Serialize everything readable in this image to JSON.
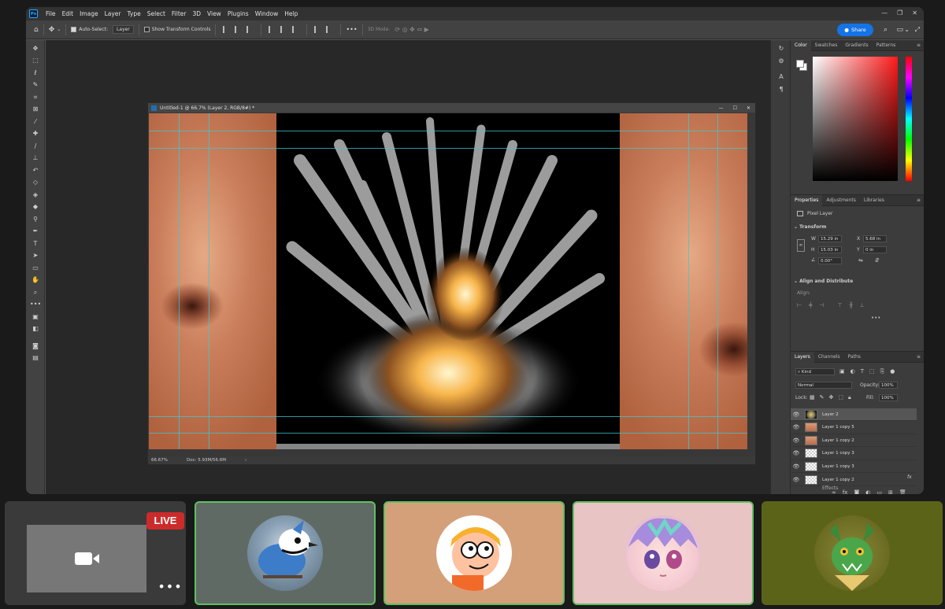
{
  "menubar": {
    "logo": "Ps",
    "items": [
      "File",
      "Edit",
      "Image",
      "Layer",
      "Type",
      "Select",
      "Filter",
      "3D",
      "View",
      "Plugins",
      "Window",
      "Help"
    ]
  },
  "options_bar": {
    "auto_select_label": "Auto-Select:",
    "auto_select_target": "Layer",
    "show_transform_label": "Show Transform Controls",
    "mode_3d_label": "3D Mode:",
    "share_label": "Share"
  },
  "document": {
    "title": "Untitled-1 @ 66.7% (Layer 2, RGB/8#) *",
    "zoom_status": "66.67%",
    "doc_size": "Doc: 5.93M/56.6M"
  },
  "color_panel": {
    "tabs": [
      "Color",
      "Swatches",
      "Gradients",
      "Patterns"
    ],
    "active_tab": "Color",
    "fg_color": "#ffffff",
    "bg_color": "#ffffff"
  },
  "properties_panel": {
    "tabs": [
      "Properties",
      "Adjustments",
      "Libraries"
    ],
    "active_tab": "Properties",
    "layer_type": "Pixel Layer",
    "transform_heading": "Transform",
    "w_label": "W",
    "w_value": "15.29 in",
    "h_label": "H",
    "h_value": "15.03 in",
    "x_label": "X",
    "x_value": "5.68 in",
    "y_label": "Y",
    "y_value": "0 in",
    "angle_value": "0.00°",
    "align_heading": "Align and Distribute",
    "align_label": "Align:"
  },
  "layers_panel": {
    "tabs": [
      "Layers",
      "Channels",
      "Paths"
    ],
    "active_tab": "Layers",
    "filter_kind": "Kind",
    "blend_mode": "Normal",
    "opacity_label": "Opacity:",
    "opacity_value": "100%",
    "lock_label": "Lock:",
    "fill_label": "Fill:",
    "fill_value": "100%",
    "layers": [
      {
        "name": "Layer 2",
        "thumb": "boom",
        "selected": true
      },
      {
        "name": "Layer 1 copy 5",
        "thumb": "face",
        "selected": false
      },
      {
        "name": "Layer 1 copy 2",
        "thumb": "face",
        "selected": false
      },
      {
        "name": "Layer 1 copy 3",
        "thumb": "empty",
        "selected": false
      },
      {
        "name": "Layer 1 copy 3",
        "thumb": "empty",
        "selected": false
      },
      {
        "name": "Layer 1 copy 2",
        "thumb": "empty",
        "selected": false
      }
    ],
    "effects_label": "Effects",
    "fx_label": "fx"
  },
  "meeting": {
    "live_label": "LIVE",
    "more_label": "•••",
    "tiles": [
      {
        "name": "bluejay",
        "bg": "#606a64",
        "speaking": true
      },
      {
        "name": "cartoon-orange",
        "bg": "#d4a07a",
        "speaking": true
      },
      {
        "name": "anime-girl",
        "bg": "#e9c4c4",
        "speaking": true
      },
      {
        "name": "green-dragon",
        "bg": "#5b6319",
        "speaking": false
      }
    ]
  }
}
